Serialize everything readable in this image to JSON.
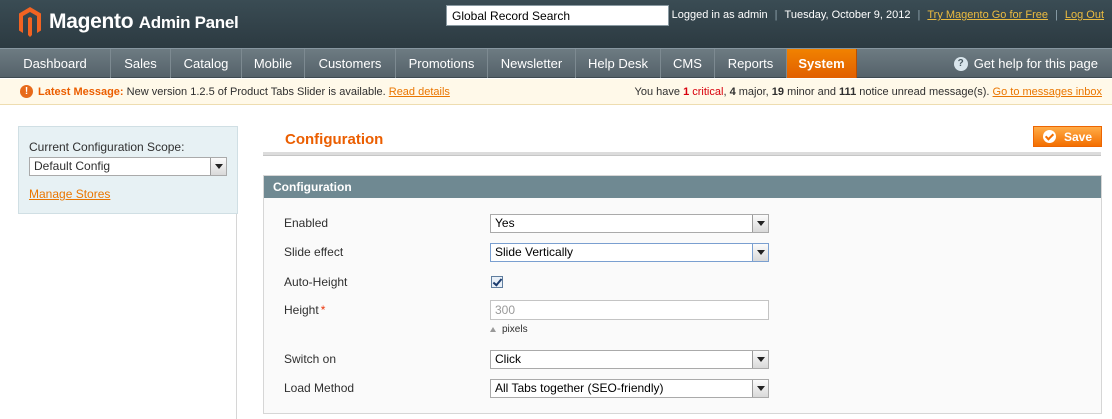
{
  "header": {
    "logo_brand": "Magento",
    "logo_sub": "Admin Panel",
    "search_value": "Global Record Search",
    "logged_in": "Logged in as admin",
    "date": "Tuesday, October 9, 2012",
    "try_link": "Try Magento Go for Free",
    "logout_link": "Log Out"
  },
  "nav": {
    "items": [
      "Dashboard",
      "Sales",
      "Catalog",
      "Mobile",
      "Customers",
      "Promotions",
      "Newsletter",
      "Help Desk",
      "CMS",
      "Reports",
      "System"
    ],
    "active": "System",
    "help": "Get help for this page"
  },
  "message": {
    "title": "Latest Message:",
    "text": " New version 1.2.5 of Product Tabs Slider is available. ",
    "read_details": "Read details",
    "summary_prefix": "You have ",
    "critical_count": "1",
    "critical_label": " critical",
    "major_count": "4",
    "major_label": " major, ",
    "minor_count": "19",
    "minor_label": " minor and ",
    "notice_count": "111",
    "notice_label": " notice unread message(s). ",
    "inbox_link": "Go to messages inbox"
  },
  "sidebar": {
    "scope_label": "Current Configuration Scope:",
    "scope_value": "Default Config",
    "manage_stores": "Manage Stores"
  },
  "main": {
    "page_title": "Configuration",
    "save_label": "Save",
    "fieldset_title": "Configuration",
    "fields": {
      "enabled": {
        "label": "Enabled",
        "value": "Yes"
      },
      "slide_effect": {
        "label": "Slide effect",
        "value": "Slide Vertically"
      },
      "auto_height": {
        "label": "Auto-Height",
        "checked": true
      },
      "height": {
        "label": "Height",
        "required_mark": "*",
        "value": "300",
        "note": "pixels"
      },
      "switch_on": {
        "label": "Switch on",
        "value": "Click"
      },
      "load_method": {
        "label": "Load Method",
        "value": "All Tabs together (SEO-friendly)"
      }
    }
  },
  "colors": {
    "accent": "#eb5e00",
    "header_bg": "#2c3a41",
    "nav_bg": "#5f6d74",
    "fieldset_head": "#6f8992",
    "link": "#ea7601"
  }
}
